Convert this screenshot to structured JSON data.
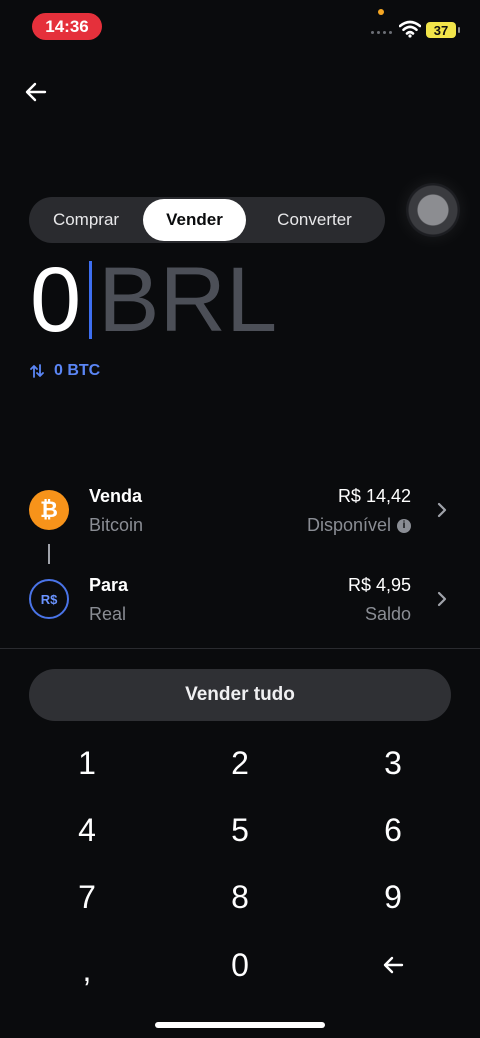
{
  "status_bar": {
    "time": "14:36",
    "battery": "37",
    "icons": [
      "signal-dots-icon",
      "wifi-icon",
      "battery-icon"
    ]
  },
  "nav": {
    "back_icon": "arrow-left-icon"
  },
  "segment": {
    "tabs": [
      {
        "label": "Comprar",
        "selected": false
      },
      {
        "label": "Vender",
        "selected": true
      },
      {
        "label": "Converter",
        "selected": false
      }
    ]
  },
  "amount": {
    "value": "0",
    "currency": "BRL",
    "converted": "0 BTC",
    "swap_icon": "swap-arrows-icon"
  },
  "sell_row": {
    "title": "Venda",
    "asset": "Bitcoin",
    "amount": "R$ 14,42",
    "meta": "Disponível",
    "icon": "bitcoin-icon",
    "info_icon": "info-icon"
  },
  "to_row": {
    "title": "Para",
    "asset": "Real",
    "amount": "R$ 4,95",
    "meta": "Saldo",
    "icon_text": "R$"
  },
  "actions": {
    "sell_all": "Vender tudo"
  },
  "keypad": {
    "keys": [
      "1",
      "2",
      "3",
      "4",
      "5",
      "6",
      "7",
      "8",
      "9",
      ",",
      "0"
    ],
    "backspace_icon": "backspace-arrow-icon"
  },
  "colors": {
    "background": "#0a0b0d",
    "accent_blue": "#3d6ef0",
    "bitcoin_orange": "#f7931a",
    "time_pill_red": "#e5303b"
  }
}
